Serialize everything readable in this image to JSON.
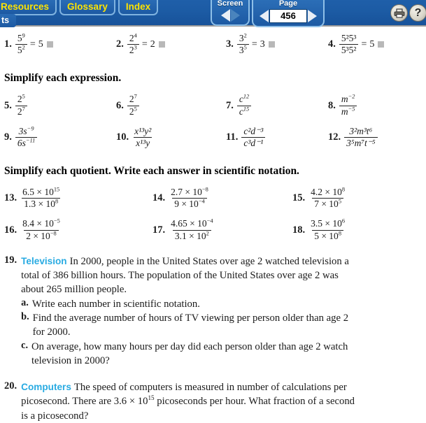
{
  "topbar": {
    "tabs": [
      {
        "label": "Resources",
        "cut": true
      },
      {
        "label": "Glossary",
        "cut": false
      },
      {
        "label": "Index",
        "cut": false
      }
    ],
    "subtab_label": "ts",
    "screen_nav": {
      "label": "Screen"
    },
    "page_nav": {
      "label": "Page",
      "value": "456"
    },
    "print_label": "print-icon",
    "help_label": "?",
    "accent_blue": "#1d5aa3",
    "tab_text_color": "#ffe400"
  },
  "content": {
    "headings": {
      "simplify_expression": "Simplify each expression.",
      "simplify_quotient": "Simplify each quotient. Write each answer in scientific notation."
    },
    "row1": [
      {
        "num": "1.",
        "num_top": "5",
        "num_top_sup": "9",
        "den": "5",
        "den_sup": "2",
        "eq": "=",
        "base": "5"
      },
      {
        "num": "2.",
        "num_top": "2",
        "num_top_sup": "4",
        "den": "2",
        "den_sup": "3",
        "eq": "=",
        "base": "2"
      },
      {
        "num": "3.",
        "num_top": "3",
        "num_top_sup": "2",
        "den": "3",
        "den_sup": "5",
        "eq": "=",
        "base": "3"
      },
      {
        "num": "4.",
        "num_top": "5²5³",
        "den": "5³5²",
        "eq": "=",
        "base": "5"
      }
    ],
    "row2": [
      {
        "num": "5.",
        "numerator": "2",
        "num_sup": "5",
        "denominator": "2",
        "den_sup": "7"
      },
      {
        "num": "6.",
        "numerator": "2",
        "num_sup": "7",
        "denominator": "2",
        "den_sup": "5"
      },
      {
        "num": "7.",
        "numerator": "c",
        "num_sup": "12",
        "denominator": "c",
        "den_sup": "15"
      },
      {
        "num": "8.",
        "numerator": "m",
        "num_sup": "−2",
        "denominator": "m",
        "den_sup": "−5"
      }
    ],
    "row3": [
      {
        "num": "9.",
        "numerator": "3s",
        "num_sup": "−9",
        "denominator": "6s",
        "den_sup": "−11"
      },
      {
        "num": "10.",
        "numerator": "x¹³y²",
        "denominator": "x¹³y"
      },
      {
        "num": "11.",
        "numerator": "c²d⁻³",
        "denominator": "c³d⁻¹"
      },
      {
        "num": "12.",
        "numerator": "3²m³t⁶",
        "denominator": "3⁵m⁷t⁻⁵"
      }
    ],
    "row4": [
      {
        "num": "13.",
        "numerator": "6.5 × 10",
        "num_sup": "15",
        "denominator": "1.3 × 10",
        "den_sup": "8"
      },
      {
        "num": "14.",
        "numerator": "2.7 × 10",
        "num_sup": "−8",
        "denominator": "9 × 10",
        "den_sup": "−4"
      },
      {
        "num": "15.",
        "numerator": "4.2 × 10",
        "num_sup": "8",
        "denominator": "7 × 10",
        "den_sup": "5"
      }
    ],
    "row5": [
      {
        "num": "16.",
        "numerator": "8.4 × 10",
        "num_sup": "−5",
        "denominator": "2 × 10",
        "den_sup": "−8"
      },
      {
        "num": "17.",
        "numerator": "4.65 × 10",
        "num_sup": "−4",
        "denominator": "3.1 × 10",
        "den_sup": "2"
      },
      {
        "num": "18.",
        "numerator": "3.5 × 10",
        "num_sup": "6",
        "denominator": "5 × 10",
        "den_sup": "8"
      }
    ],
    "problem19": {
      "num": "19.",
      "topic": "Television",
      "body": "In 2000, people in the United States over age 2 watched television a total of 386 billion hours. The population of the United States over age 2 was about 265 million people.",
      "parts": [
        {
          "label": "a.",
          "text": "Write each number in scientific notation."
        },
        {
          "label": "b.",
          "text": "Find the average number of hours of TV viewing per person older than age 2 for 2000."
        },
        {
          "label": "c.",
          "text": "On average, how many hours per day did each person older than age 2 watch television in 2000?"
        }
      ]
    },
    "problem20": {
      "num": "20.",
      "topic": "Computers",
      "body_before": "The speed of computers is measured in number of calculations per picosecond. There are 3.6 × 10",
      "body_exp": "15",
      "body_after": " picoseconds per hour. What fraction of a second is a picosecond?"
    }
  }
}
